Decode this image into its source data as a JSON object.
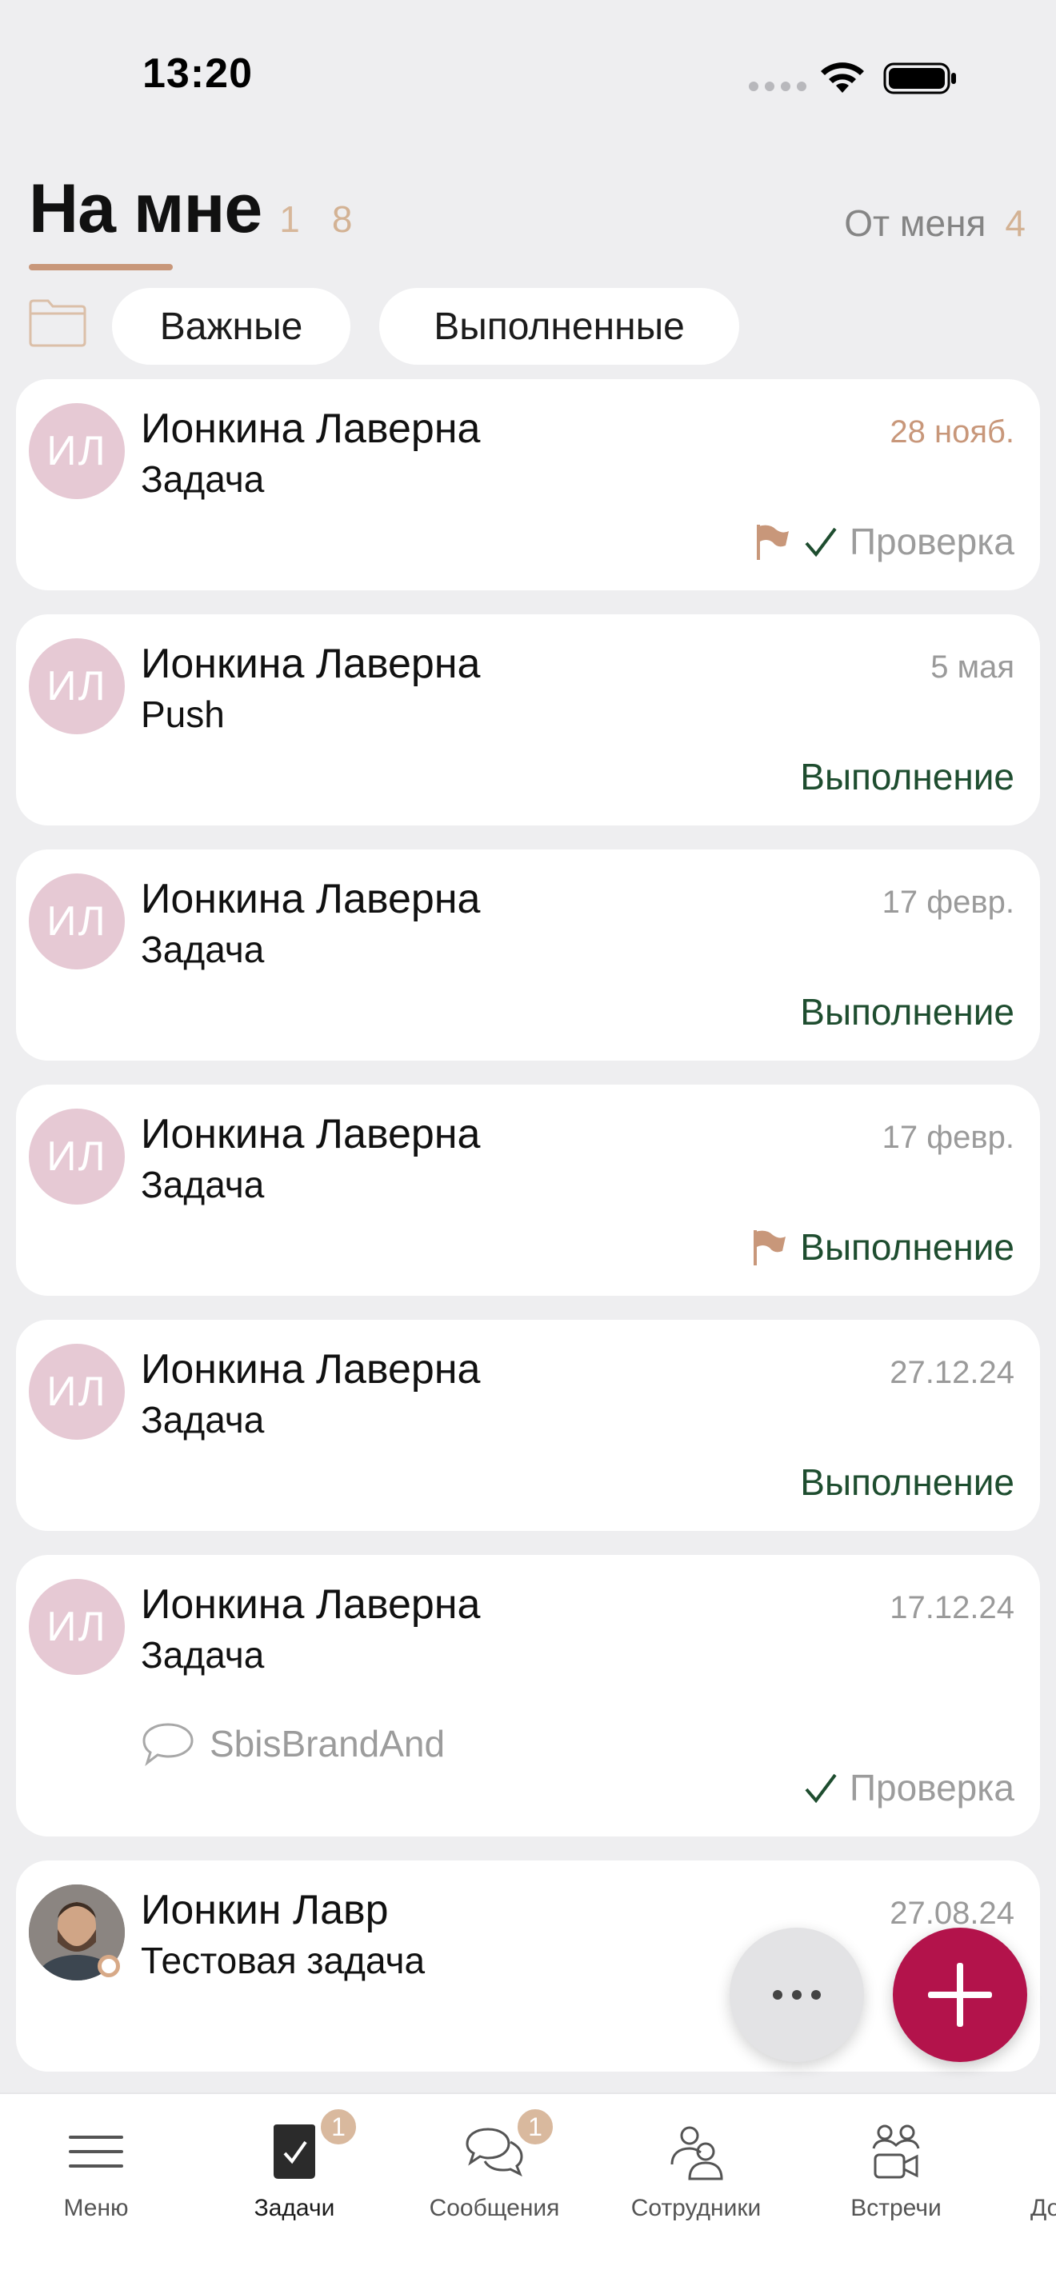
{
  "status_bar": {
    "time": "13:20"
  },
  "tabs": {
    "main": {
      "label": "На мне",
      "count_a": "1",
      "count_b": "8"
    },
    "secondary": {
      "label": "От меня",
      "count": "4"
    }
  },
  "filters": {
    "important": "Важные",
    "done": "Выполненные"
  },
  "tasks": [
    {
      "avatar": "ИЛ",
      "name": "Ионкина Лаверна",
      "subject": "Задача",
      "date": "28 нояб.",
      "status": "Проверка"
    },
    {
      "avatar": "ИЛ",
      "name": "Ионкина Лаверна",
      "subject": "Push",
      "date": "5 мая",
      "status": "Выполнение"
    },
    {
      "avatar": "ИЛ",
      "name": "Ионкина Лаверна",
      "subject": "Задача",
      "date": "17 февр.",
      "status": "Выполнение"
    },
    {
      "avatar": "ИЛ",
      "name": "Ионкина Лаверна",
      "subject": "Задача",
      "date": "17 февр.",
      "status": "Выполнение"
    },
    {
      "avatar": "ИЛ",
      "name": "Ионкина Лаверна",
      "subject": "Задача",
      "date": "27.12.24",
      "status": "Выполнение"
    },
    {
      "avatar": "ИЛ",
      "name": "Ионкина Лаверна",
      "subject": "Задача",
      "date": "17.12.24",
      "comment": "SbisBrandAnd",
      "status": "Проверка"
    },
    {
      "name": "Ионкин Лавр",
      "subject": "Тестовая задача",
      "date": "27.08.24"
    }
  ],
  "bottom_nav": {
    "menu": "Меню",
    "tasks": "Задачи",
    "tasks_badge": "1",
    "messages": "Сообщения",
    "messages_badge": "1",
    "employees": "Сотрудники",
    "meetings": "Встречи",
    "more_partial": "До"
  },
  "colors": {
    "accent": "#c8977a",
    "fab_add": "#b3134b",
    "status_exec": "#1e4d2f",
    "avatar_bg": "#e6c9d4"
  }
}
